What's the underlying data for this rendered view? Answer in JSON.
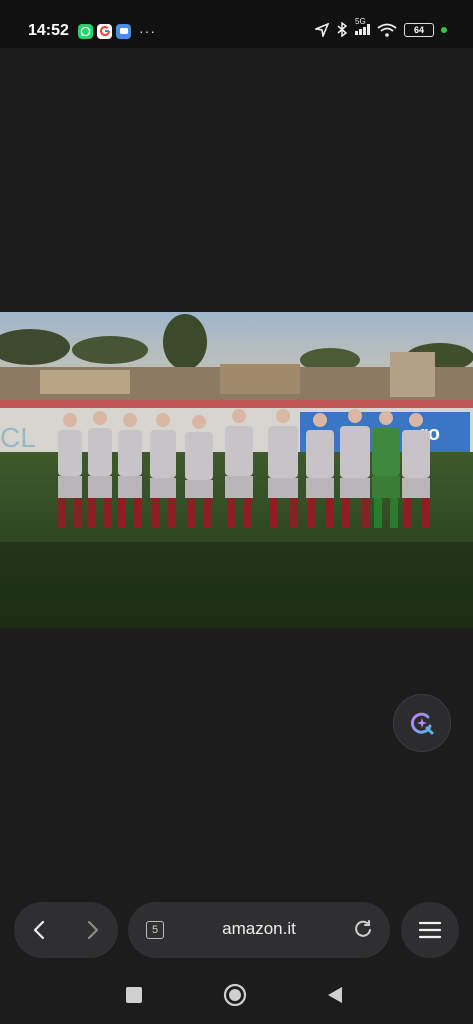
{
  "status_bar": {
    "time": "14:52",
    "notification_apps": [
      {
        "icon": "whatsapp-icon",
        "color": "#25d366"
      },
      {
        "icon": "google-icon",
        "color": "#ffffff"
      },
      {
        "icon": "messages-icon",
        "color": "#4a90e2"
      }
    ],
    "more_indicator": "···",
    "network": "5G",
    "battery_level": "64",
    "battery_dot_color": "#3ec34a"
  },
  "image_viewer": {
    "image_subject": "football-team-lineup-photo",
    "background_color": "#1c1c1c",
    "banner_text": "ro",
    "banner_partial_left": "CL"
  },
  "browser_toolbar": {
    "back_icon": "chevron-left-icon",
    "forward_icon": "chevron-right-icon",
    "tab_count": "5",
    "url": "amazon.it",
    "reload_icon": "reload-icon",
    "menu_icon": "hamburger-menu-icon"
  },
  "system_nav": {
    "recents_icon": "square-icon",
    "home_icon": "circle-icon",
    "back_icon": "triangle-back-icon"
  }
}
